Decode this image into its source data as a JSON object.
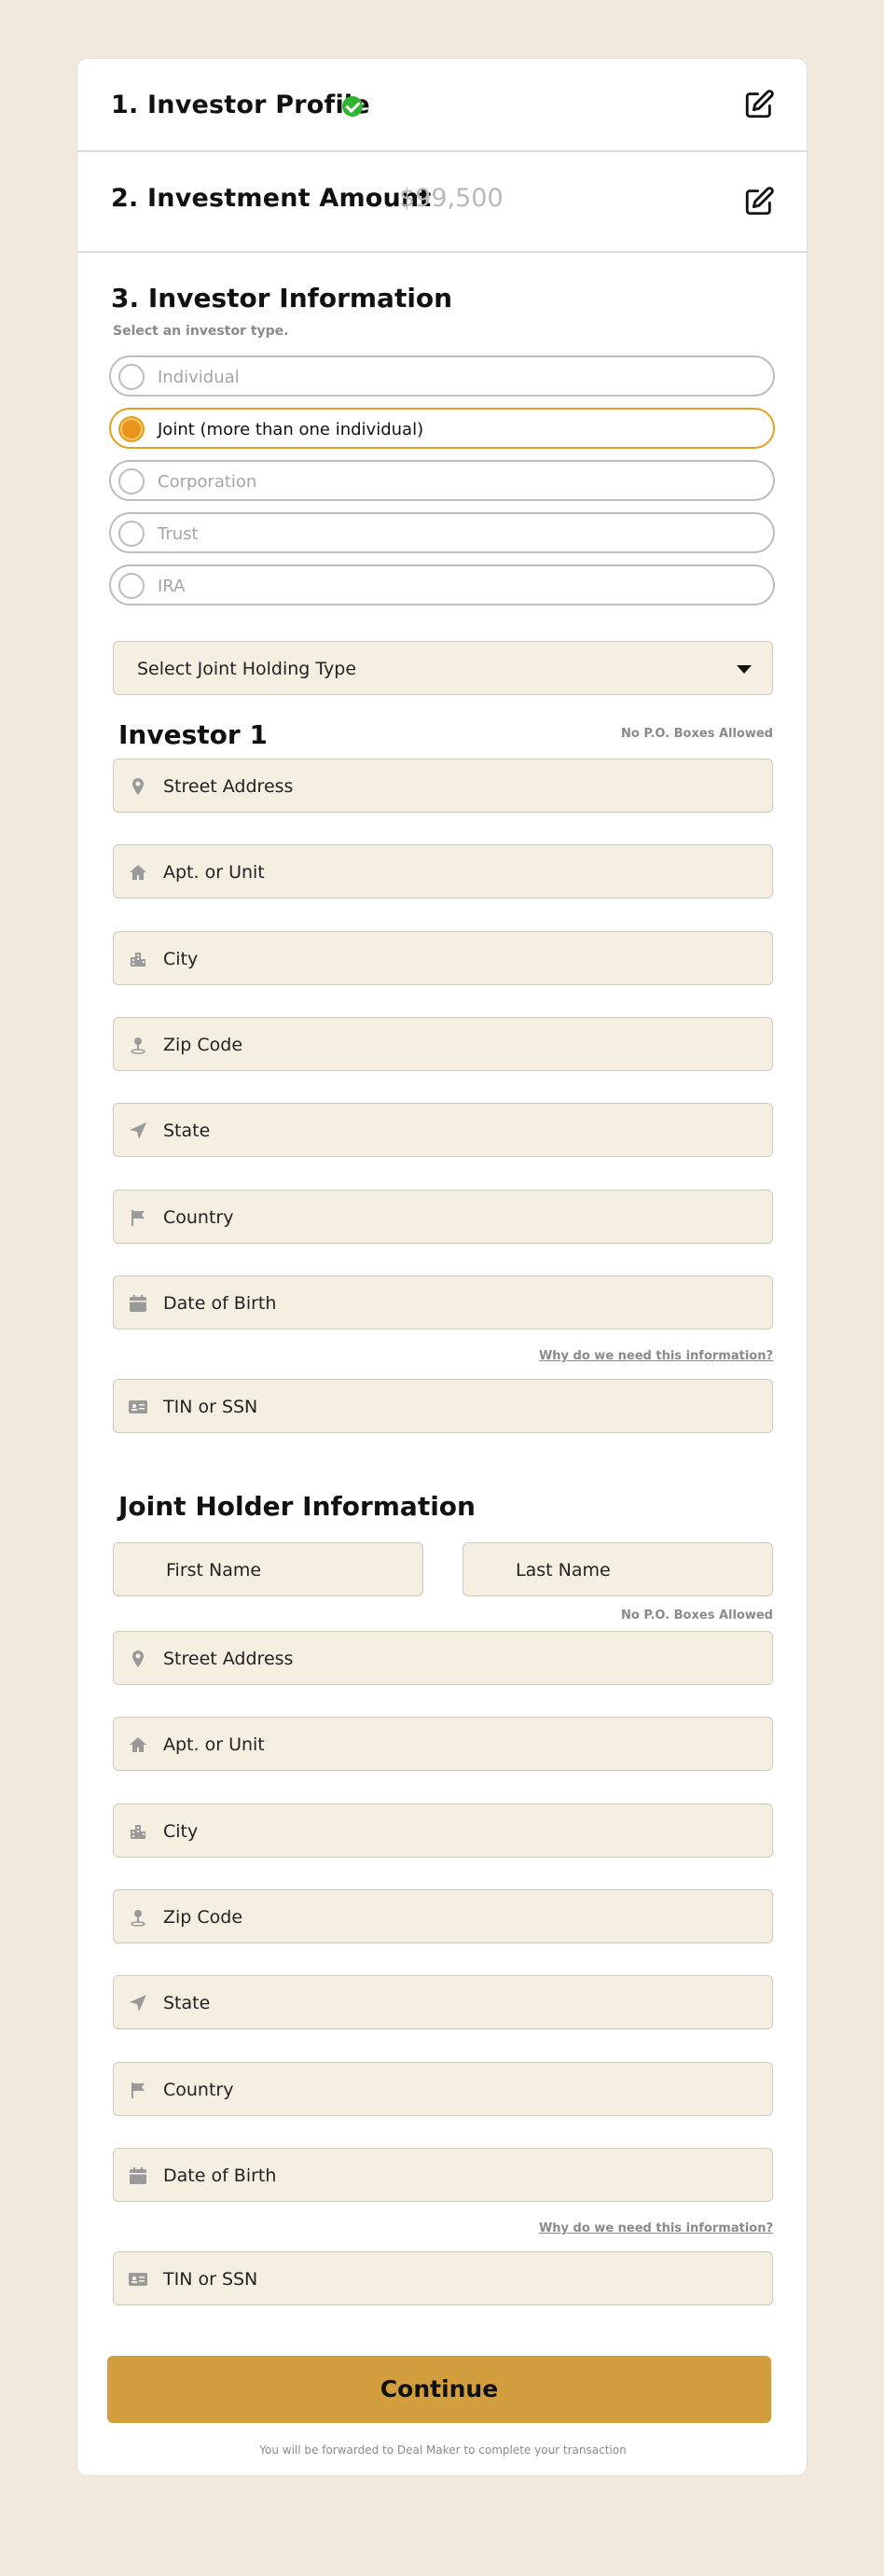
{
  "steps": {
    "profile": {
      "title": "1. Investor Profile",
      "status_icon": "check-circle-icon"
    },
    "amount": {
      "title": "2. Investment Amount",
      "value": "$99,500"
    },
    "info": {
      "title": "3. Investor Information",
      "subtitle": "Select an investor type."
    }
  },
  "investor_types": [
    {
      "label": "Individual",
      "selected": false
    },
    {
      "label": "Joint (more than one individual)",
      "selected": true
    },
    {
      "label": "Corporation",
      "selected": false
    },
    {
      "label": "Trust",
      "selected": false
    },
    {
      "label": "IRA",
      "selected": false
    }
  ],
  "joint_holding": {
    "placeholder": "Select Joint Holding Type"
  },
  "investor1": {
    "title": "Investor 1",
    "note": "No P.O. Boxes Allowed",
    "fields": {
      "street": "Street Address",
      "apt": "Apt. or Unit",
      "city": "City",
      "zip": "Zip Code",
      "state": "State",
      "country": "Country",
      "dob": "Date of Birth",
      "tin": "TIN or SSN"
    },
    "why_link": "Why do we need this information?"
  },
  "joint_holder": {
    "title": "Joint Holder Information",
    "first_name": "First Name",
    "last_name": "Last Name",
    "note": "No P.O. Boxes Allowed",
    "fields": {
      "street": "Street Address",
      "apt": "Apt. or Unit",
      "city": "City",
      "zip": "Zip Code",
      "state": "State",
      "country": "Country",
      "dob": "Date of Birth",
      "tin": "TIN or SSN"
    },
    "why_link": "Why do we need this information?"
  },
  "continue_label": "Continue",
  "footnote": "You will be forwarded to Deal Maker to complete your transaction",
  "colors": {
    "accent": "#d39e3d",
    "selected_radio": "#e8961b",
    "field_bg": "#f5efe1",
    "page_bg": "#f0e9dc",
    "success": "#2fb52f"
  }
}
